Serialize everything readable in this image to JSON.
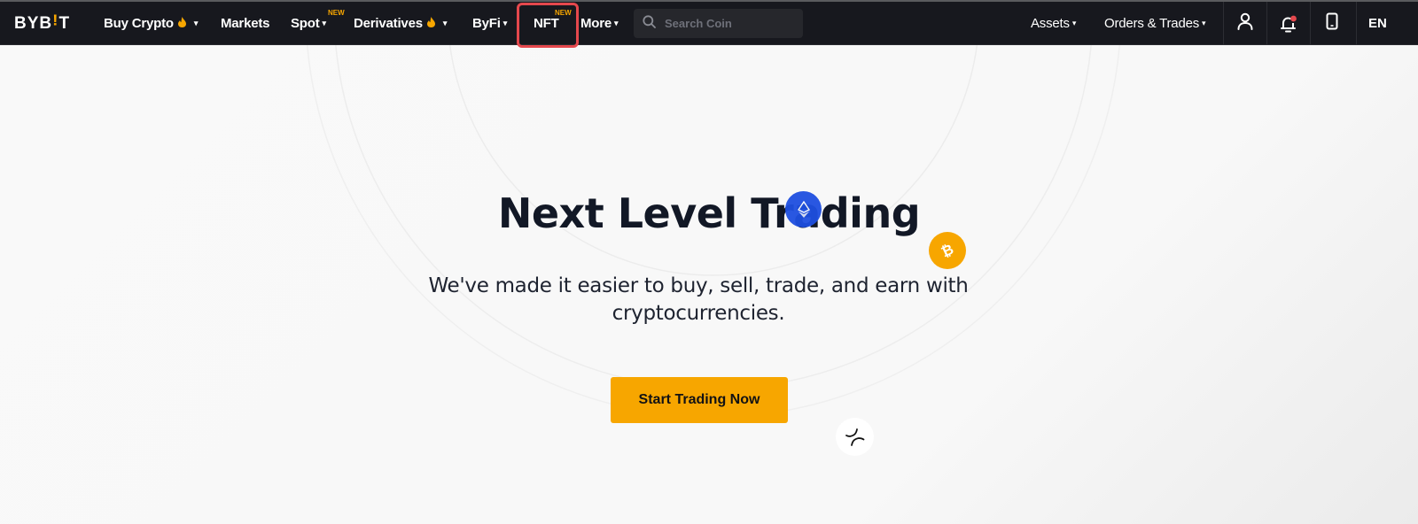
{
  "nav": {
    "logo": {
      "text_left": "BYB",
      "text_bar": "!",
      "text_right": "T"
    },
    "items": [
      {
        "label": "Buy Crypto",
        "hot": true,
        "dropdown": true
      },
      {
        "label": "Markets",
        "hot": false,
        "dropdown": false
      },
      {
        "label": "Spot",
        "hot": false,
        "dropdown": true,
        "badge": "NEW"
      },
      {
        "label": "Derivatives",
        "hot": true,
        "dropdown": true
      },
      {
        "label": "ByFi",
        "hot": false,
        "dropdown": true
      },
      {
        "label": "NFT",
        "hot": false,
        "dropdown": false,
        "badge": "NEW",
        "highlighted": true
      },
      {
        "label": "More",
        "hot": false,
        "dropdown": true
      }
    ],
    "search": {
      "placeholder": "Search Coin",
      "value": ""
    },
    "right_items": [
      {
        "label": "Assets",
        "dropdown": true
      },
      {
        "label": "Orders & Trades",
        "dropdown": true
      }
    ],
    "icons": [
      "user-icon",
      "bell-icon",
      "mobile-icon"
    ],
    "notification_dot": true,
    "language": "EN",
    "caret": "▾",
    "flame": "🔥"
  },
  "hero": {
    "title": "Next Level Trading",
    "subtitle": "We've made it easier to buy, sell, trade, and earn with cryptocurrencies.",
    "cta_label": "Start Trading Now",
    "coins": [
      "ethereum",
      "bitcoin",
      "xrp"
    ]
  },
  "colors": {
    "nav_bg": "#17181e",
    "accent": "#f7a600",
    "highlight_border": "#e5484d",
    "title": "#121826",
    "eth_blue": "#1e4fe0",
    "notification": "#e5484d"
  }
}
